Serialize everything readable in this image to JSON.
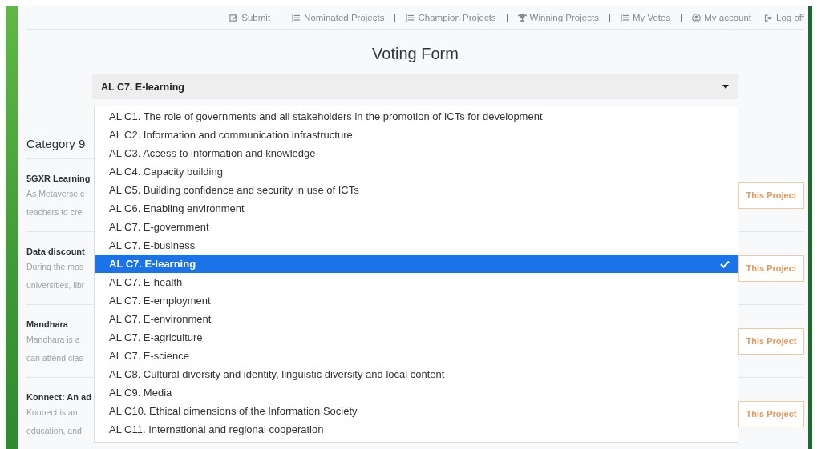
{
  "nav": [
    {
      "label": "Submit",
      "kind": "edit",
      "separator_after": true
    },
    {
      "label": "Nominated Projects",
      "kind": "list",
      "separator_after": true
    },
    {
      "label": "Champion Projects",
      "kind": "list",
      "separator_after": true
    },
    {
      "label": "Winning Projects",
      "kind": "trophy",
      "separator_after": true
    },
    {
      "label": "My Votes",
      "kind": "list",
      "separator_after": true
    },
    {
      "label": "My account",
      "kind": "user",
      "separator_after": false
    },
    {
      "label": "Log off",
      "kind": "logout",
      "separator_after": false
    }
  ],
  "title": "Voting Form",
  "select": {
    "value": "AL C7. E-learning",
    "expanded": true,
    "options": [
      {
        "label": "AL C1. The role of governments and all stakeholders in the promotion of ICTs for development",
        "selected": false
      },
      {
        "label": "AL C2. Information and communication infrastructure",
        "selected": false
      },
      {
        "label": "AL C3. Access to information and knowledge",
        "selected": false
      },
      {
        "label": "AL C4. Capacity building",
        "selected": false
      },
      {
        "label": "AL C5. Building confidence and security in use of ICTs",
        "selected": false
      },
      {
        "label": "AL C6. Enabling environment",
        "selected": false
      },
      {
        "label": "AL C7. E-government",
        "selected": false
      },
      {
        "label": "AL C7. E-business",
        "selected": false
      },
      {
        "label": "AL C7. E-learning",
        "selected": true
      },
      {
        "label": "AL C7. E-health",
        "selected": false
      },
      {
        "label": "AL C7. E-employment",
        "selected": false
      },
      {
        "label": "AL C7. E-environment",
        "selected": false
      },
      {
        "label": "AL C7. E-agriculture",
        "selected": false
      },
      {
        "label": "AL C7. E-science",
        "selected": false
      },
      {
        "label": "AL C8. Cultural diversity and identity, linguistic diversity and local content",
        "selected": false
      },
      {
        "label": "AL C9. Media",
        "selected": false
      },
      {
        "label": "AL C10. Ethical dimensions of the Information Society",
        "selected": false
      },
      {
        "label": "AL C11. International and regional cooperation",
        "selected": false
      }
    ]
  },
  "category": "Category 9",
  "projects": [
    {
      "title": "5GXR Learning",
      "description_lines": [
        "As Metaverse c",
        "teachers to cre"
      ],
      "button": "This Project"
    },
    {
      "title": "Data discount",
      "description_lines": [
        "During the mos",
        "universities, libr"
      ],
      "button": "This Project"
    },
    {
      "title": "Mandhara",
      "description_lines": [
        "Mandhara is a",
        "can attend clas"
      ],
      "button": "This Project"
    },
    {
      "title": "Konnect: An ad",
      "description_lines": [
        "Konnect is an",
        "education, and"
      ],
      "button": "This Project"
    }
  ]
}
